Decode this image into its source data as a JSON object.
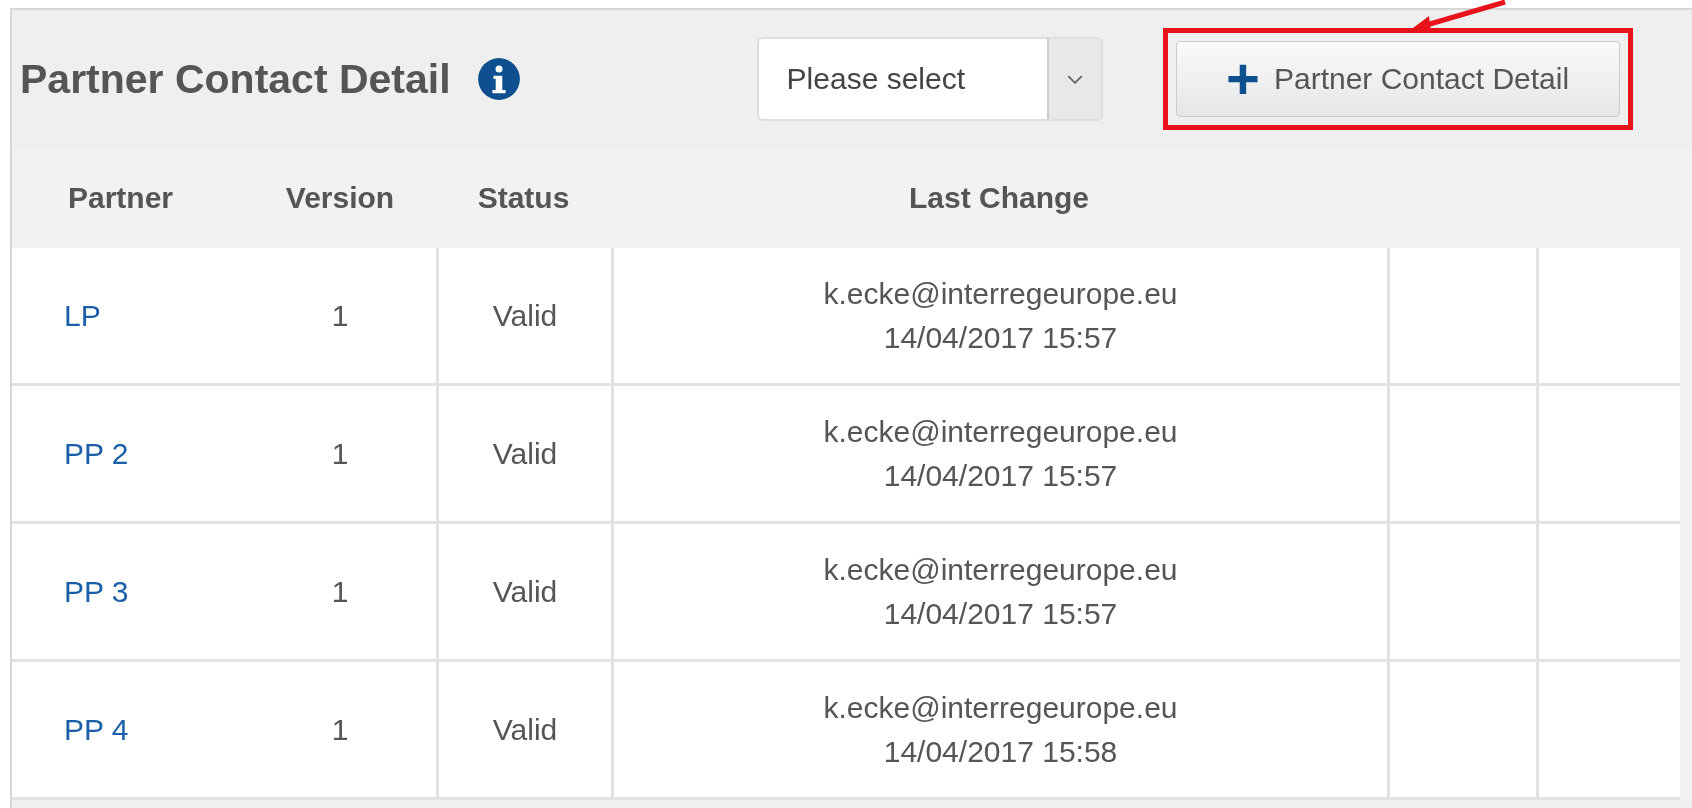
{
  "panel": {
    "title": "Partner Contact Detail",
    "select": {
      "placeholder": "Please select"
    },
    "add_button": {
      "icon": "+",
      "label": "Partner Contact Detail",
      "highlighted": true
    }
  },
  "table": {
    "columns": [
      "Partner",
      "Version",
      "Status",
      "Last Change"
    ],
    "rows": [
      {
        "partner": "LP",
        "version": "1",
        "status": "Valid",
        "user": "k.ecke@interregeurope.eu",
        "date": "14/04/2017 15:57"
      },
      {
        "partner": "PP 2",
        "version": "1",
        "status": "Valid",
        "user": "k.ecke@interregeurope.eu",
        "date": "14/04/2017 15:57"
      },
      {
        "partner": "PP 3",
        "version": "1",
        "status": "Valid",
        "user": "k.ecke@interregeurope.eu",
        "date": "14/04/2017 15:57"
      },
      {
        "partner": "PP 4",
        "version": "1",
        "status": "Valid",
        "user": "k.ecke@interregeurope.eu",
        "date": "14/04/2017 15:58"
      }
    ]
  }
}
